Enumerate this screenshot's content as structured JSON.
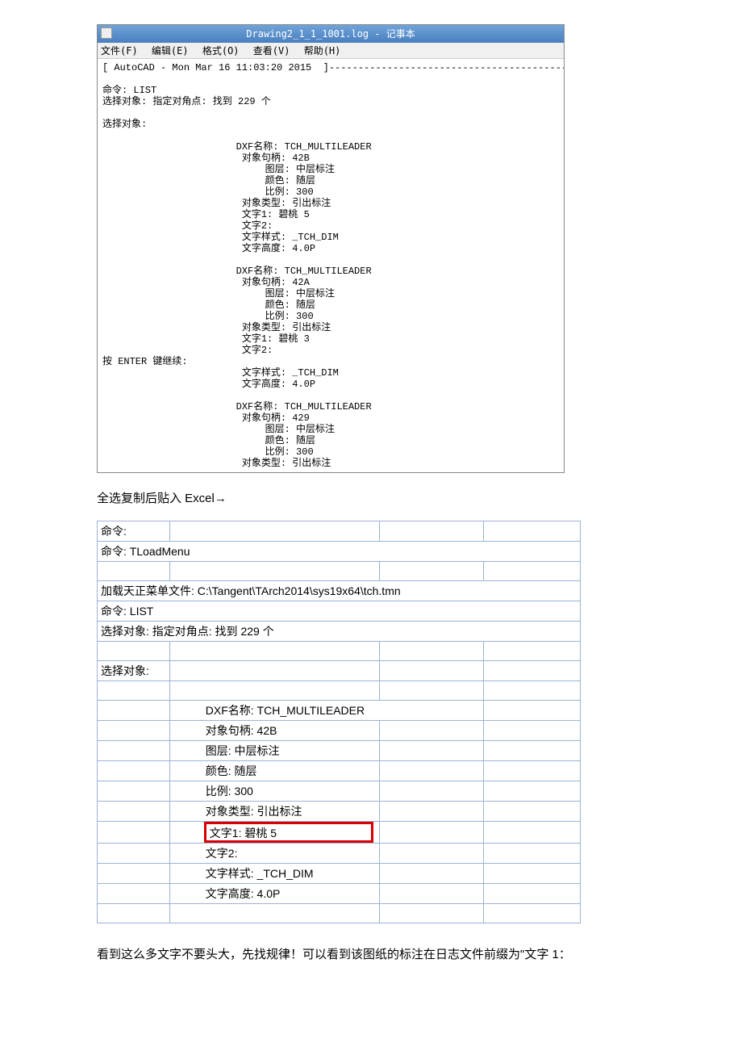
{
  "notepad": {
    "title": "Drawing2_1_1_1001.log - 记事本",
    "menu": {
      "file": "文件(F)",
      "edit": "编辑(E)",
      "format": "格式(O)",
      "view": "查看(V)",
      "help": "帮助(H)"
    },
    "body": "[ AutoCAD - Mon Mar 16 11:03:20 2015  ]-----------------------------------------\n\n命令: LIST\n选择对象: 指定对角点: 找到 229 个\n\n选择对象:\n\n                       DXF名称: TCH_MULTILEADER\n                        对象句柄: 42B\n                            图层: 中层标注\n                            颜色: 随层\n                            比例: 300\n                        对象类型: 引出标注\n                        文字1: 碧桃 5\n                        文字2:\n                        文字样式: _TCH_DIM\n                        文字高度: 4.0P\n\n                       DXF名称: TCH_MULTILEADER\n                        对象句柄: 42A\n                            图层: 中层标注\n                            颜色: 随层\n                            比例: 300\n                        对象类型: 引出标注\n                        文字1: 碧桃 3\n                        文字2:\n按 ENTER 键继续:\n                        文字样式: _TCH_DIM\n                        文字高度: 4.0P\n\n                       DXF名称: TCH_MULTILEADER\n                        对象句柄: 429\n                            图层: 中层标注\n                            颜色: 随层\n                            比例: 300\n                        对象类型: 引出标注"
  },
  "instruction": "全选复制后贴入 Excel→",
  "excel": {
    "r1": "命令:",
    "r2": "命令: TLoadMenu",
    "r3": "加载天正菜单文件: C:\\Tangent\\TArch2014\\sys19x64\\tch.tmn",
    "r4": "命令: LIST",
    "r5": "选择对象: 指定对角点: 找到 229 个",
    "r6": "选择对象:",
    "r7": "DXF名称: TCH_MULTILEADER",
    "r8": "对象句柄: 42B",
    "r9": "图层: 中层标注",
    "r10": "颜色: 随层",
    "r11": "比例: 300",
    "r12": "对象类型: 引出标注",
    "r13": "文字1: 碧桃 5",
    "r14": "文字2:",
    "r15": "文字样式: _TCH_DIM",
    "r16": "文字高度: 4.0P"
  },
  "footer": "看到这么多文字不要头大，先找规律！可以看到该图纸的标注在日志文件前缀为\"文字 1："
}
